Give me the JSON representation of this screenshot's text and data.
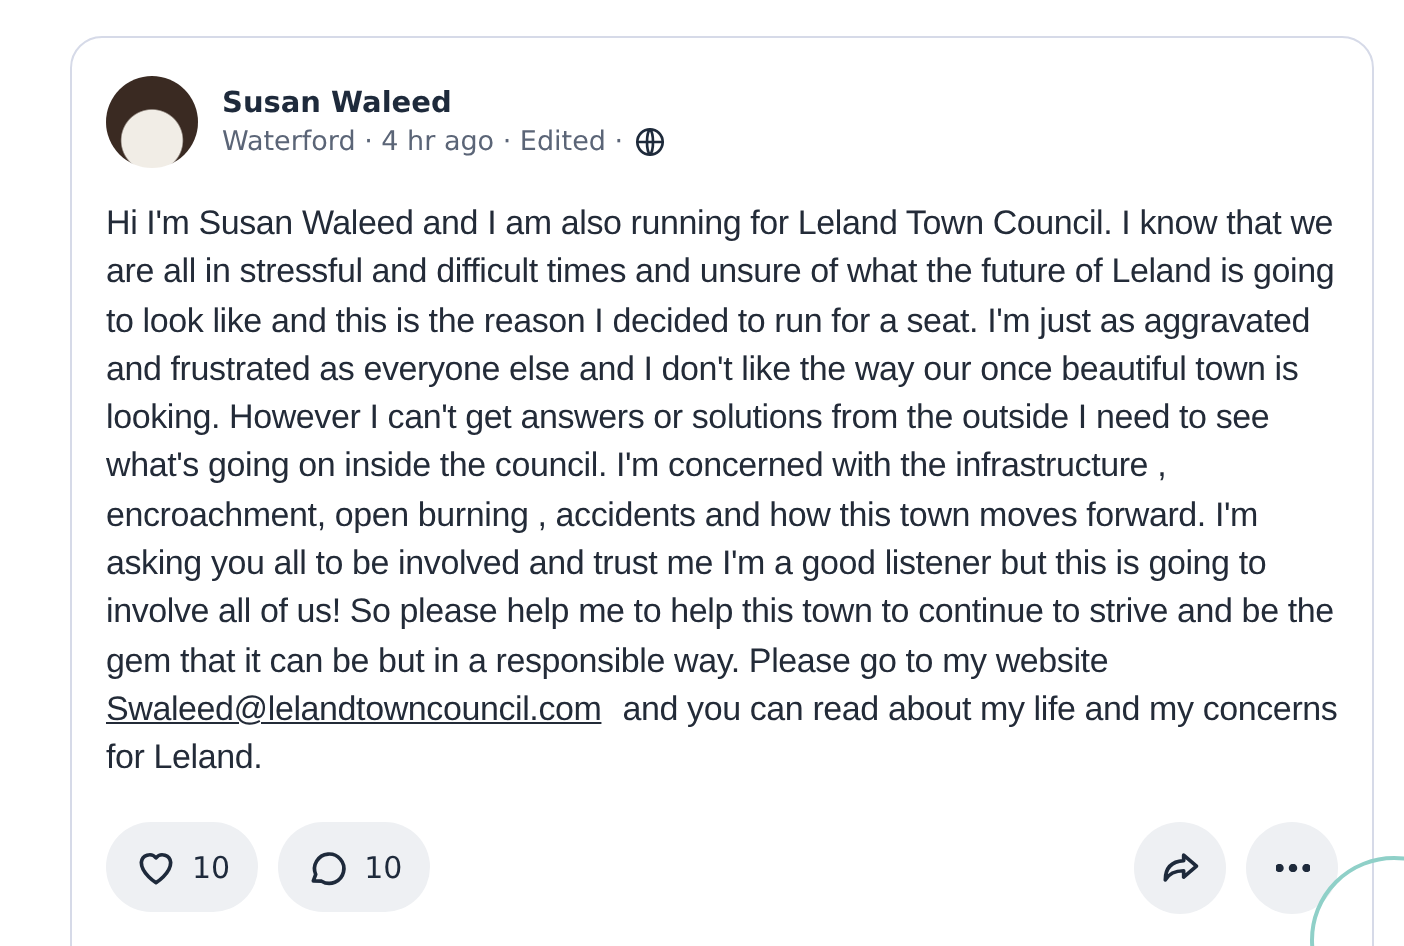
{
  "post": {
    "author": "Susan Waleed",
    "meta": "Waterford · 4 hr ago · Edited ·",
    "body": {
      "before": "Hi I'm Susan Waleed and I am also running for Leland Town Council. I know that we are all in stressful and difficult times and unsure of what the future of Leland is going to look like and this is the reason I decided to run for a seat. I'm just as aggravated and frustrated as everyone else and I don't like the way our once beautiful town is looking. However I can't get answers or solutions from the outside I need to see what's going on inside the council. I'm concerned with the infrastructure , encroachment, open burning , accidents and how this town moves forward. I'm asking you all to be involved and trust me I'm a good listener but this is going to involve all of us! So please help me to help this town to continue to strive and be the gem that it can be but in a responsible way. Please go to my website",
      "link": "Swaleed@lelandtowncouncil.com",
      "after": "and you can read about my life and my concerns for Leland."
    },
    "likes": "10",
    "comments": "10"
  }
}
